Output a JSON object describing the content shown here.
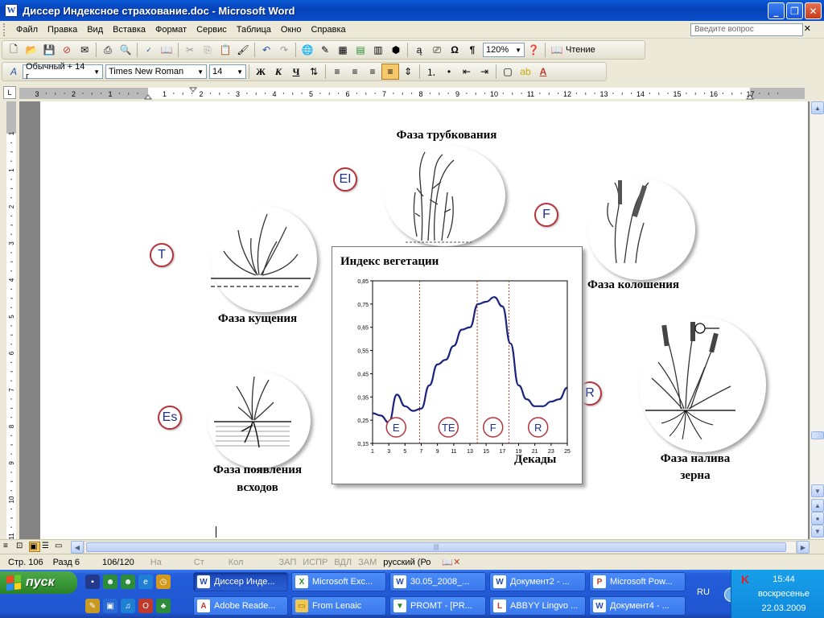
{
  "window": {
    "title": "Диссер Индексное страхование.doc - Microsoft Word",
    "app_icon_letter": "W"
  },
  "menu": {
    "items": [
      "Файл",
      "Правка",
      "Вид",
      "Вставка",
      "Формат",
      "Сервис",
      "Таблица",
      "Окно",
      "Справка"
    ],
    "help_placeholder": "Введите вопрос"
  },
  "toolbar": {
    "zoom": "120%",
    "reading_label": "Чтение",
    "style": "Обычный + 14 г",
    "font": "Times New Roman",
    "size": "14"
  },
  "ruler": {
    "numbers": [
      "3",
      "2",
      "1",
      "1",
      "2",
      "3",
      "4",
      "5",
      "6",
      "7",
      "8",
      "9",
      "10",
      "11",
      "12",
      "13",
      "14",
      "15",
      "16",
      "17"
    ],
    "vnumbers": [
      "1",
      "1",
      "2",
      "3",
      "4",
      "5",
      "6",
      "7",
      "8",
      "9",
      "10",
      "11"
    ]
  },
  "document": {
    "phases": {
      "tubing": "Фаза трубкования",
      "heading": "Фаза колошения",
      "tillering": "Фаза кущения",
      "emergence_1": "Фаза появления",
      "emergence_2": "всходов",
      "grain_1": "Фаза налива",
      "grain_2": "зерна"
    },
    "badges": {
      "ei": "EI",
      "f": "F",
      "t": "T",
      "es": "Es",
      "r": "R"
    }
  },
  "chart_data": {
    "type": "line",
    "title": "Индекс вегетации",
    "xlabel": "Декады",
    "ylabel": "",
    "x_ticks": [
      "1",
      "3",
      "5",
      "7",
      "9",
      "11",
      "13",
      "15",
      "17",
      "19",
      "21",
      "23",
      "25"
    ],
    "y_ticks": [
      "0,85",
      "0,75",
      "0,65",
      "0,55",
      "0,45",
      "0,35",
      "0,25",
      "0,15"
    ],
    "xlim": [
      1,
      25
    ],
    "ylim": [
      0.15,
      0.85
    ],
    "series": [
      {
        "x": [
          1,
          2,
          3,
          4,
          5,
          6,
          7,
          8,
          9,
          10,
          11,
          12,
          13,
          14,
          15,
          16,
          17,
          18,
          19,
          20,
          21,
          22,
          23,
          24,
          25
        ],
        "y": [
          0.28,
          0.27,
          0.24,
          0.36,
          0.31,
          0.29,
          0.3,
          0.4,
          0.49,
          0.51,
          0.57,
          0.64,
          0.65,
          0.75,
          0.76,
          0.78,
          0.74,
          0.58,
          0.4,
          0.34,
          0.31,
          0.31,
          0.33,
          0.34,
          0.39
        ]
      }
    ],
    "phase_dividers_x": [
      6.8,
      13.9,
      17.8
    ],
    "phase_labels": [
      "E",
      "TE",
      "F",
      "R"
    ],
    "colors": {
      "line": "#1a237e",
      "divider": "#c0392b",
      "badge_border": "#b4343e",
      "badge_text": "#1f2f8a"
    }
  },
  "status": {
    "page": "Стр. 106",
    "section": "Разд 6",
    "pages": "106/120",
    "at": "На",
    "line": "Ст",
    "col": "Кол",
    "rec": "ЗАП",
    "trk": "ИСПР",
    "ext": "ВДЛ",
    "ovr": "ЗАМ",
    "lang": "русский (Ро"
  },
  "taskbar": {
    "start": "пуск",
    "tasks_row1": [
      "Диссер Инде...",
      "Microsoft Exc...",
      "30.05_2008_...",
      "Документ2 - ...",
      "Microsoft Pow..."
    ],
    "tasks_row2": [
      "Adobe Reade...",
      "From Lenaic",
      "PROMT - [PR...",
      "ABBYY Lingvo ...",
      "Документ4 - ..."
    ],
    "lang": "RU",
    "time": "15:44",
    "day": "воскресенье",
    "date": "22.03.2009"
  }
}
